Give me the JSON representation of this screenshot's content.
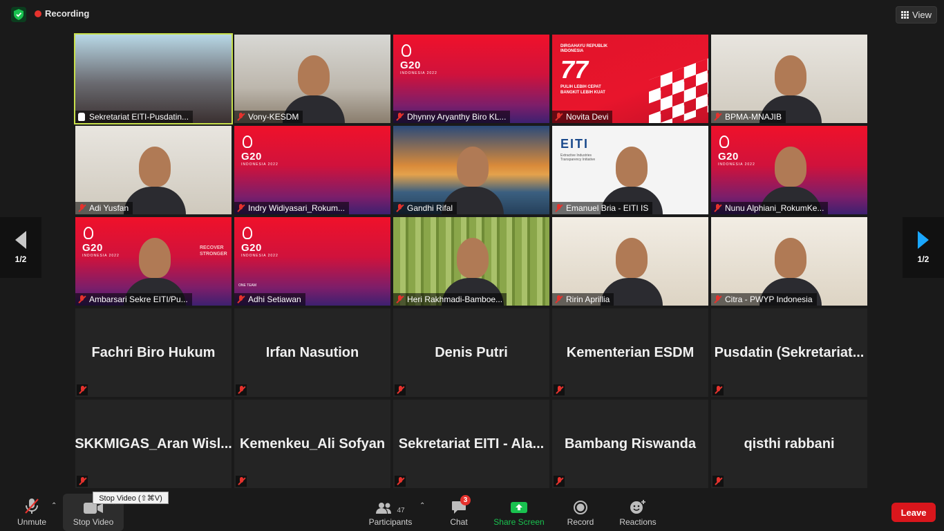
{
  "topbar": {
    "recording_label": "Recording",
    "view_label": "View",
    "colors": {
      "recording": "#e5322d",
      "shield": "#19c24f"
    }
  },
  "tiles_video": [
    {
      "name": "Sekretariat EITI-Pusdatin...",
      "bg": "stage",
      "active": true,
      "muted": false
    },
    {
      "name": "Vony-KESDM",
      "bg": "room",
      "active": false,
      "muted": true
    },
    {
      "name": "Dhynny Aryanthy Biro KL...",
      "bg": "g20",
      "active": false,
      "muted": true
    },
    {
      "name": "Novita Devi",
      "bg": "dirgahayu",
      "active": false,
      "muted": true
    },
    {
      "name": "BPMA-MNAJIB",
      "bg": "office",
      "active": false,
      "muted": true
    },
    {
      "name": "Adi Yusfan",
      "bg": "office",
      "active": false,
      "muted": true
    },
    {
      "name": "Indry Widiyasari_Rokum...",
      "bg": "g20",
      "active": false,
      "muted": true
    },
    {
      "name": "Gandhi Rifal",
      "bg": "bridge",
      "active": false,
      "muted": true
    },
    {
      "name": "Emanuel Bria - EITI IS",
      "bg": "eiti",
      "active": false,
      "muted": true
    },
    {
      "name": "Nunu Alphiani_RokumKe...",
      "bg": "g20",
      "active": false,
      "muted": true
    },
    {
      "name": "Ambarsari Sekre EITI/Pu...",
      "bg": "g20",
      "active": false,
      "muted": true
    },
    {
      "name": "Adhi Setiawan",
      "bg": "g20",
      "active": false,
      "muted": true
    },
    {
      "name": "Heri Rakhmadi-Bamboe...",
      "bg": "bamboo",
      "active": false,
      "muted": true
    },
    {
      "name": "Ririn Aprillia",
      "bg": "home",
      "active": false,
      "muted": true
    },
    {
      "name": "Citra - PWYP Indonesia",
      "bg": "home",
      "active": false,
      "muted": true
    }
  ],
  "tiles_names": [
    "Fachri Biro Hukum",
    "Irfan Nasution",
    "Denis Putri",
    "Kementerian ESDM",
    "Pusdatin (Sekretariat...",
    "SKKMIGAS_Aran Wisl...",
    "Kemenkeu_Ali Sofyan",
    "Sekretariat EITI - Ala...",
    "Bambang Riswanda",
    "qisthi rabbani"
  ],
  "tile_text": {
    "g20": "G20",
    "g20_sub": "INDONESIA 2022",
    "dirgahayu": "DIRGAHAYU REPUBLIK INDONESIA",
    "seventy_seven": "77",
    "pulih": "PULIH LEBIH CEPAT BANGKIT LEBIH KUAT",
    "eiti": "EITI",
    "eiti_sub": "Extractive Industries Transparency Initiative",
    "recover": "RECOVER STRONGER",
    "ambarsari_g20": "G20 INDONESIA 2022",
    "one_team": "ONE TEAM"
  },
  "pager": {
    "left": "1/2",
    "right": "1/2"
  },
  "toolbar": {
    "unmute": "Unmute",
    "stop_video": "Stop Video",
    "tooltip": "Stop Video (⇧⌘V)",
    "participants": "Participants",
    "participants_count": "47",
    "chat": "Chat",
    "chat_badge": "3",
    "share_screen": "Share Screen",
    "record": "Record",
    "reactions": "Reactions",
    "leave": "Leave"
  }
}
